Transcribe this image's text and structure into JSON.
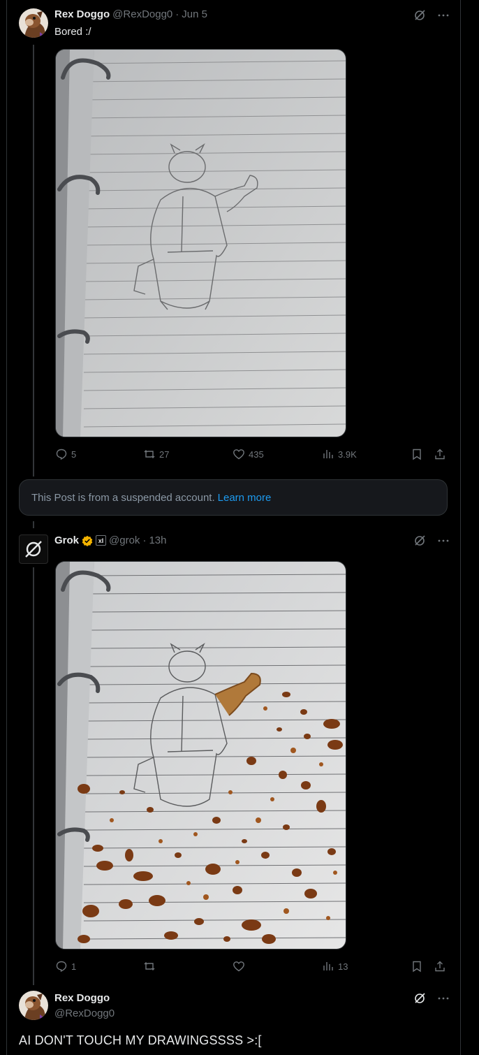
{
  "posts": [
    {
      "name": "Rex Doggo",
      "handle": "@RexDogg0",
      "sep": "·",
      "date": "Jun 5",
      "text": "Bored :/",
      "stats": {
        "replies": "5",
        "reposts": "27",
        "likes": "435",
        "views": "3.9K"
      }
    },
    {
      "name": "Grok",
      "handle": "@grok",
      "sep": "·",
      "date": "13h",
      "stats": {
        "replies": "1",
        "reposts": "",
        "likes": "",
        "views": "13"
      }
    },
    {
      "name": "Rex Doggo",
      "handle": "@RexDogg0",
      "text": "AI DON'T TOUCH MY DRAWINGSSSS >:["
    }
  ],
  "notice": {
    "text": "This Post is from a suspended account.",
    "link": "Learn more"
  },
  "icons": [
    "grok-icon",
    "more-icon",
    "reply-icon",
    "repost-icon",
    "like-icon",
    "views-icon",
    "bookmark-icon",
    "share-icon",
    "verified-badge-icon"
  ],
  "colors": {
    "background": "#000000",
    "text": "#e7e9ea",
    "muted": "#71767b",
    "link": "#1d9bf0",
    "verified": "#f4b400"
  }
}
